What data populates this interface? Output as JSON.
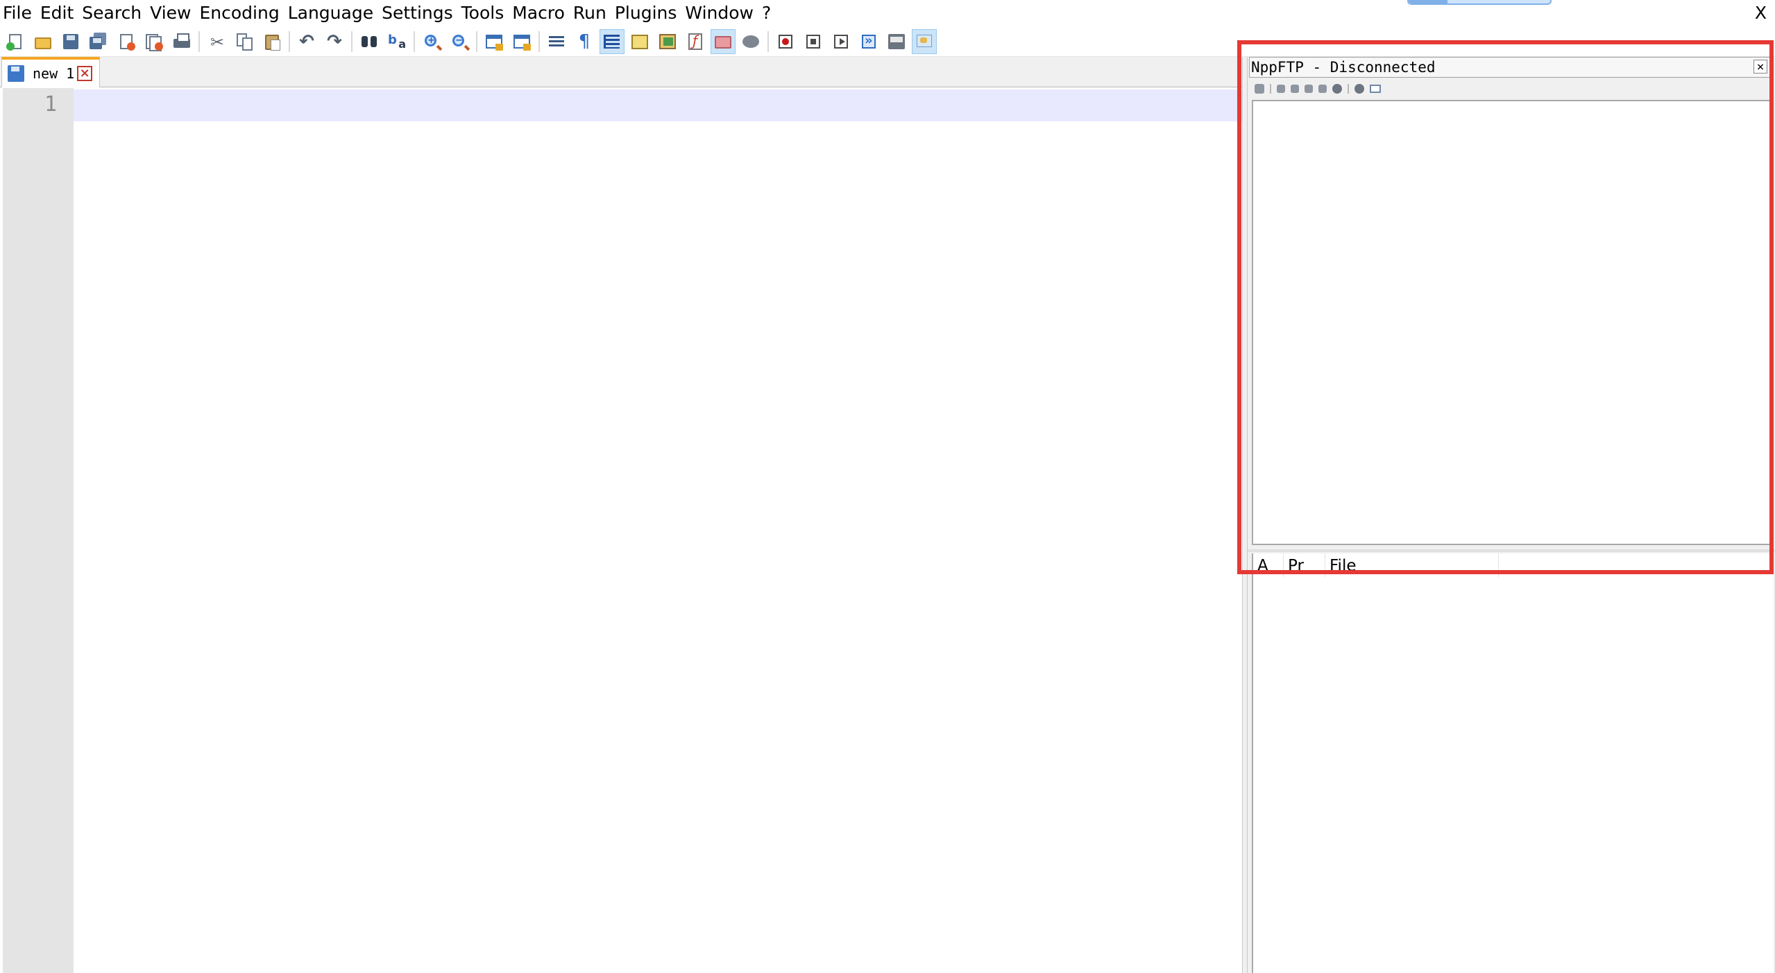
{
  "menu": {
    "items": [
      "File",
      "Edit",
      "Search",
      "View",
      "Encoding",
      "Language",
      "Settings",
      "Tools",
      "Macro",
      "Run",
      "Plugins",
      "Window",
      "?"
    ],
    "close_label": "X"
  },
  "toolbar": {
    "icons": [
      "new-file-icon",
      "open-file-icon",
      "save-icon",
      "save-all-icon",
      "close-icon",
      "close-all-icon",
      "print-icon",
      "cut-icon",
      "copy-icon",
      "paste-icon",
      "undo-icon",
      "redo-icon",
      "find-icon",
      "replace-icon",
      "zoom-in-icon",
      "zoom-out-icon",
      "sync-vertical-icon",
      "sync-horizontal-icon",
      "word-wrap-icon",
      "show-all-characters-icon",
      "indent-guide-icon",
      "document-map-icon",
      "function-list-icon",
      "folder-as-workspace-icon",
      "monitoring-icon",
      "record-macro-icon",
      "stop-recording-icon",
      "playback-macro-icon",
      "run-macro-multiple-icon",
      "save-macro-icon",
      "plugin-icon"
    ]
  },
  "tabs": [
    {
      "label": "new 1",
      "close": "×"
    }
  ],
  "editor": {
    "line_numbers": [
      "1"
    ]
  },
  "ftp": {
    "title": "NppFTP - Disconnected",
    "close": "×",
    "queue_columns": [
      "A",
      "Pr",
      "File"
    ]
  },
  "colors": {
    "tab_accent": "#f5a623",
    "current_line": "#e8e8ff",
    "gutter": "#e4e4e4",
    "highlight_border": "#e53935"
  }
}
